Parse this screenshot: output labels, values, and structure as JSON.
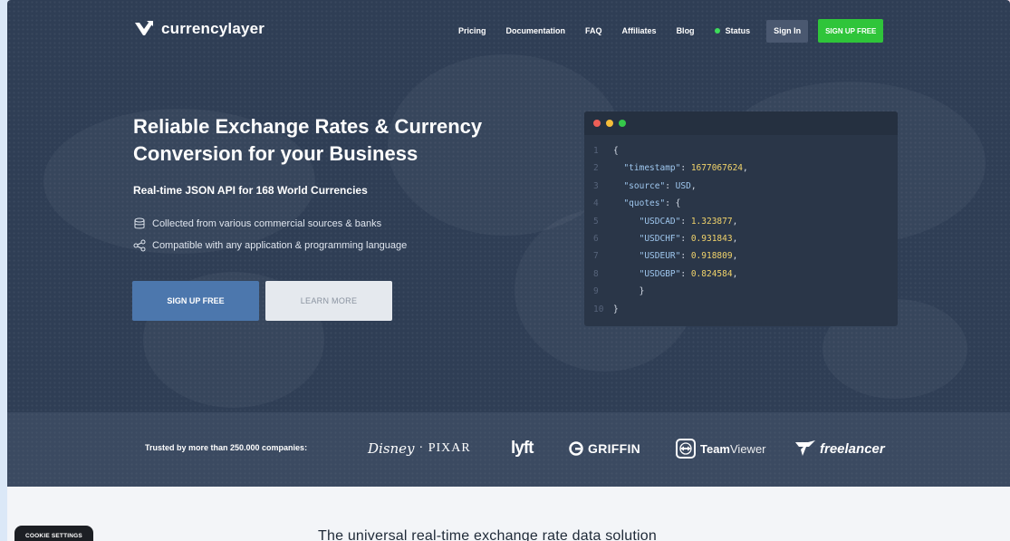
{
  "brand": {
    "name": "currencylayer"
  },
  "nav": {
    "items": [
      {
        "label": "Pricing"
      },
      {
        "label": "Documentation"
      },
      {
        "label": "FAQ"
      },
      {
        "label": "Affiliates"
      },
      {
        "label": "Blog"
      }
    ],
    "status_label": "Status",
    "status_color": "#3ddc5a",
    "signin_label": "Sign In",
    "signup_label": "SIGN UP FREE"
  },
  "hero": {
    "headline": "Reliable Exchange Rates & Currency Conversion for your Business",
    "subhead": "Real-time JSON API for 168 World Currencies",
    "features": [
      {
        "icon": "database-icon",
        "text": "Collected from various commercial sources & banks"
      },
      {
        "icon": "share-icon",
        "text": "Compatible with any application & programming language"
      }
    ],
    "cta_primary": "SIGN UP FREE",
    "cta_secondary": "LEARN MORE"
  },
  "code": {
    "window_dots": [
      "#ed5f57",
      "#f5bd3a",
      "#35c84a"
    ],
    "line_numbers": [
      "1",
      "2",
      "3",
      "4",
      "5",
      "6",
      "7",
      "8",
      "9",
      "10"
    ],
    "l1": "{",
    "ts_key": "\"timestamp\"",
    "ts_val": "1677067624",
    "src_key": "\"source\"",
    "src_val": "USD",
    "quotes_key": "\"quotes\"",
    "quotes": [
      {
        "key": "\"USDCAD\"",
        "val": "1.323877"
      },
      {
        "key": "\"USDCHF\"",
        "val": "0.931843"
      },
      {
        "key": "\"USDEUR\"",
        "val": "0.918809"
      },
      {
        "key": "\"USDGBP\"",
        "val": "0.824584"
      }
    ],
    "l9": "}",
    "l10": "}"
  },
  "trust": {
    "label": "Trusted by more than 250.000 companies:",
    "brands": {
      "disney": "Disney",
      "pixar": "· PIXAR",
      "lyft": "lyft",
      "griffin": "GRIFFIN",
      "teamviewer_bold": "Team",
      "teamviewer_light": "Viewer",
      "freelancer": "freelancer"
    }
  },
  "section": {
    "title": "The universal real-time exchange rate data solution"
  },
  "cookie": {
    "label": "COOKIE SETTINGS"
  }
}
